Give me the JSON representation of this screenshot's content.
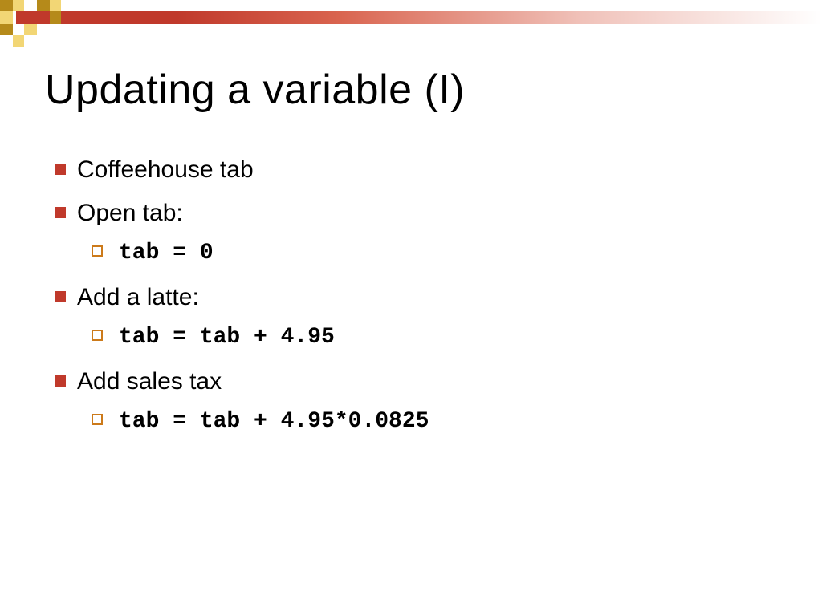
{
  "slide": {
    "title": "Updating a variable (I)",
    "items": [
      {
        "text": "Coffeehouse tab"
      },
      {
        "text": "Open tab:",
        "code": "tab = 0"
      },
      {
        "text": "Add a latte:",
        "code": "tab = tab + 4.95"
      },
      {
        "text": "Add sales tax",
        "code": "tab =  tab + 4.95*0.0825"
      }
    ]
  }
}
